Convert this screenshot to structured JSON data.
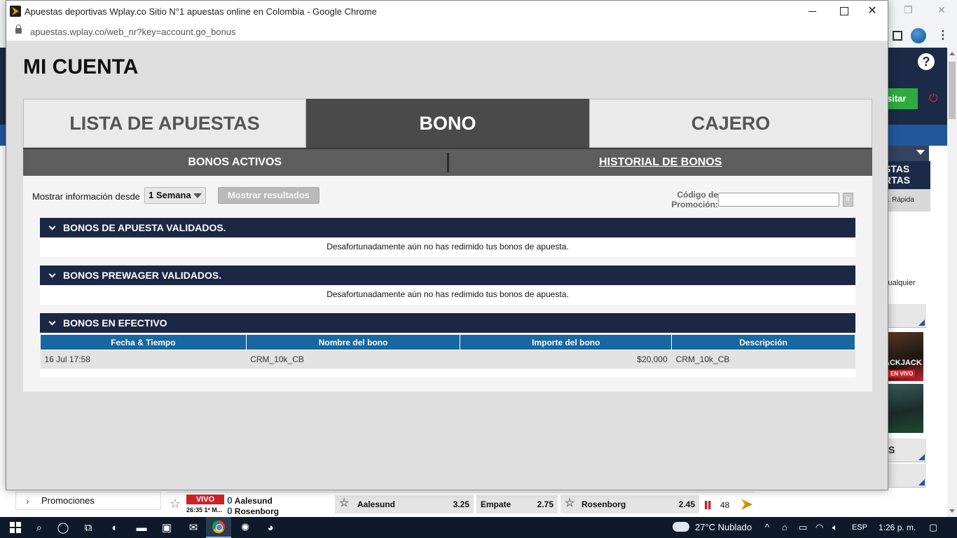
{
  "popup": {
    "window_title": "Apuestas deportivas Wplay.co Sitio N°1 apuestas online en Colombia - Google Chrome",
    "url": "apuestas.wplay.co/web_nr?key=account.go_bonus",
    "page_title": "MI CUENTA",
    "tabs": [
      {
        "label": "LISTA DE APUESTAS",
        "active": false
      },
      {
        "label": "BONO",
        "active": true
      },
      {
        "label": "CAJERO",
        "active": false
      }
    ],
    "subtabs": [
      {
        "label": "BONOS ACTIVOS"
      },
      {
        "label": "HISTORIAL DE BONOS"
      }
    ],
    "filter": {
      "label": "Mostrar información desde",
      "selected": "1 Semana",
      "button": "Mostrar resultados",
      "promo_label": "Código de Promoción:",
      "promo_value": "",
      "promo_go": "Ir"
    },
    "sections": [
      {
        "title": "BONOS DE APUESTA VALIDADOS.",
        "message": "Desafortunadamente aún no has redimido tus bonos de apuesta."
      },
      {
        "title": "BONOS PREWAGER VALIDADOS.",
        "message": "Desafortunadamente aún no has redimido tus bonos de apuesta."
      },
      {
        "title": "BONOS EN EFECTIVO"
      }
    ],
    "table": {
      "columns": [
        "Fecha & Tiempo",
        "Nombre del bono",
        "Importe del bono",
        "Descripción"
      ],
      "rows": [
        [
          "16 Jul 17:58",
          "CRM_10k_CB",
          "$20,000",
          "CRM_10k_CB"
        ]
      ]
    }
  },
  "background": {
    "visitar": "sitar",
    "side_title": "STAS\nRTAS",
    "side_sub": "a. Rápida",
    "side_text": "cualquier",
    "blackjack": "ACKJACK",
    "envivo": "EN VIVO",
    "s_label": "S",
    "promo_item": "Promociones",
    "match": {
      "status": "VIVO",
      "time": "26:35 1º M...",
      "home_score": "0",
      "home": "Aalesund",
      "away_score": "0",
      "away": "Rosenborg",
      "odds": [
        {
          "name": "Aalesund",
          "value": "3.25"
        },
        {
          "name": "Empate",
          "value": "2.75"
        },
        {
          "name": "Rosenborg",
          "value": "2.45"
        }
      ],
      "markets": "48"
    }
  },
  "taskbar": {
    "weather": "27°C  Nublado",
    "lang": "ESP",
    "clock": "1:26 p. m."
  }
}
